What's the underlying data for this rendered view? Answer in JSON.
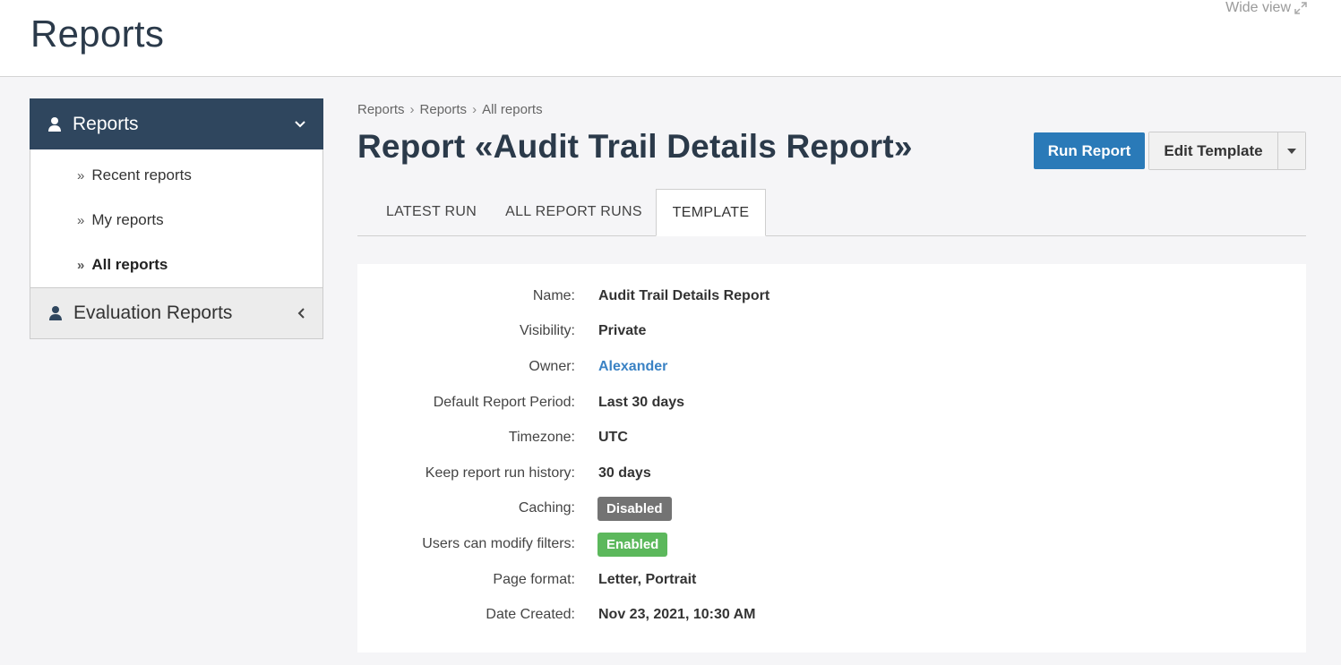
{
  "header": {
    "title": "Reports",
    "wide_view": "Wide view"
  },
  "sidebar": {
    "section1": "Reports",
    "items": [
      {
        "label": "Recent reports"
      },
      {
        "label": "My reports"
      },
      {
        "label": "All reports"
      }
    ],
    "section2": "Evaluation Reports"
  },
  "breadcrumb": [
    "Reports",
    "Reports",
    "All reports"
  ],
  "report": {
    "title": "Report «Audit Trail Details Report»",
    "run_button": "Run Report",
    "edit_button": "Edit Template"
  },
  "tabs": [
    {
      "label": "LATEST RUN"
    },
    {
      "label": "ALL REPORT RUNS"
    },
    {
      "label": "TEMPLATE"
    }
  ],
  "details": {
    "name_label": "Name:",
    "name": "Audit Trail Details Report",
    "visibility_label": "Visibility:",
    "visibility": "Private",
    "owner_label": "Owner:",
    "owner": "Alexander",
    "period_label": "Default Report Period:",
    "period": "Last 30 days",
    "timezone_label": "Timezone:",
    "timezone": "UTC",
    "history_label": "Keep report run history:",
    "history": "30 days",
    "caching_label": "Caching:",
    "caching": "Disabled",
    "filters_label": "Users can modify filters:",
    "filters": "Enabled",
    "format_label": "Page format:",
    "format": "Letter, Portrait",
    "created_label": "Date Created:",
    "created": "Nov 23, 2021, 10:30 AM"
  },
  "colors": {
    "sidebar_active": "#2f465e",
    "primary_button": "#2a7ab8",
    "badge_disabled": "#737373",
    "badge_enabled": "#5cb85c",
    "link": "#3a82c4"
  }
}
